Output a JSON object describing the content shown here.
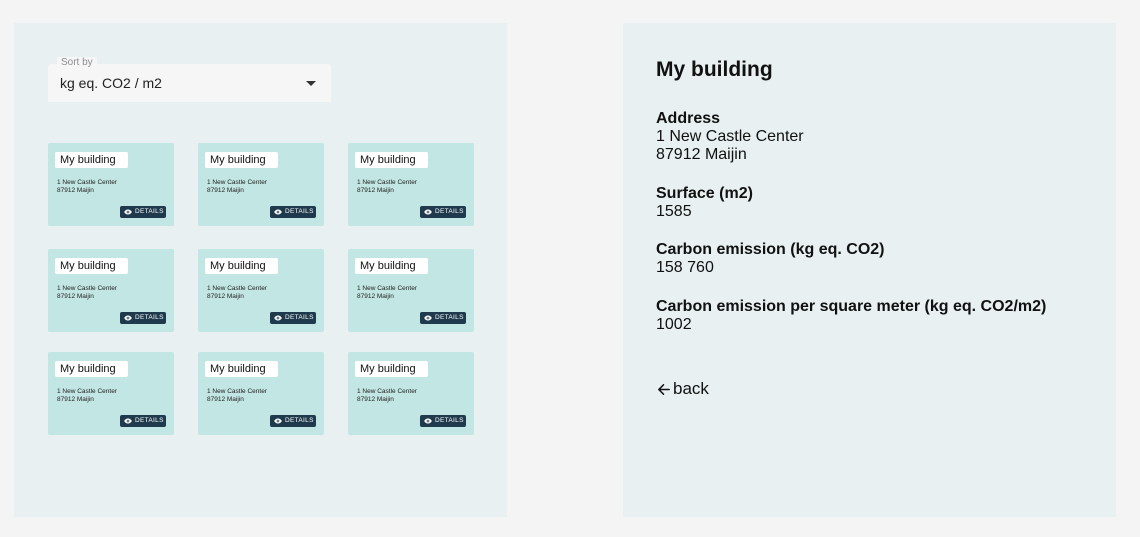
{
  "sort": {
    "label": "Sort by",
    "value": "kg eq. CO2 / m2"
  },
  "cards": [
    {
      "name": "My building",
      "address_line1": "1 New Castle Center",
      "address_line2": "87912 Maijin",
      "button": "DETAILS"
    },
    {
      "name": "My building",
      "address_line1": "1 New Castle Center",
      "address_line2": "87912 Maijin",
      "button": "DETAILS"
    },
    {
      "name": "My building",
      "address_line1": "1 New Castle Center",
      "address_line2": "87912 Maijin",
      "button": "DETAILS"
    },
    {
      "name": "My building",
      "address_line1": "1 New Castle Center",
      "address_line2": "87912 Maijin",
      "button": "DETAILS"
    },
    {
      "name": "My building",
      "address_line1": "1 New Castle Center",
      "address_line2": "87912 Maijin",
      "button": "DETAILS"
    },
    {
      "name": "My building",
      "address_line1": "1 New Castle Center",
      "address_line2": "87912 Maijin",
      "button": "DETAILS"
    },
    {
      "name": "My building",
      "address_line1": "1 New Castle Center",
      "address_line2": "87912 Maijin",
      "button": "DETAILS"
    },
    {
      "name": "My building",
      "address_line1": "1 New Castle Center",
      "address_line2": "87912 Maijin",
      "button": "DETAILS"
    },
    {
      "name": "My building",
      "address_line1": "1 New Castle Center",
      "address_line2": "87912 Maijin",
      "button": "DETAILS"
    }
  ],
  "detail": {
    "title": "My building",
    "address": {
      "label": "Address",
      "line1": "1 New Castle Center",
      "line2": "87912 Maijin"
    },
    "surface": {
      "label": "Surface (m2)",
      "value": "1585"
    },
    "carbon": {
      "label": "Carbon emission (kg eq. CO2)",
      "value": "158 760"
    },
    "carbon_per_m2": {
      "label": "Carbon emission per square meter (kg eq. CO2/m2)",
      "value": "1002"
    },
    "back": "back"
  },
  "colors": {
    "page_bg": "#f4f4f4",
    "panel_bg": "#e8f0f1",
    "card_bg": "#c2e6e3",
    "button_bg": "#1f3a4d"
  },
  "icons": {
    "sort_caret": "caret-down-icon",
    "details": "eye-icon",
    "back": "arrow-left-icon"
  }
}
